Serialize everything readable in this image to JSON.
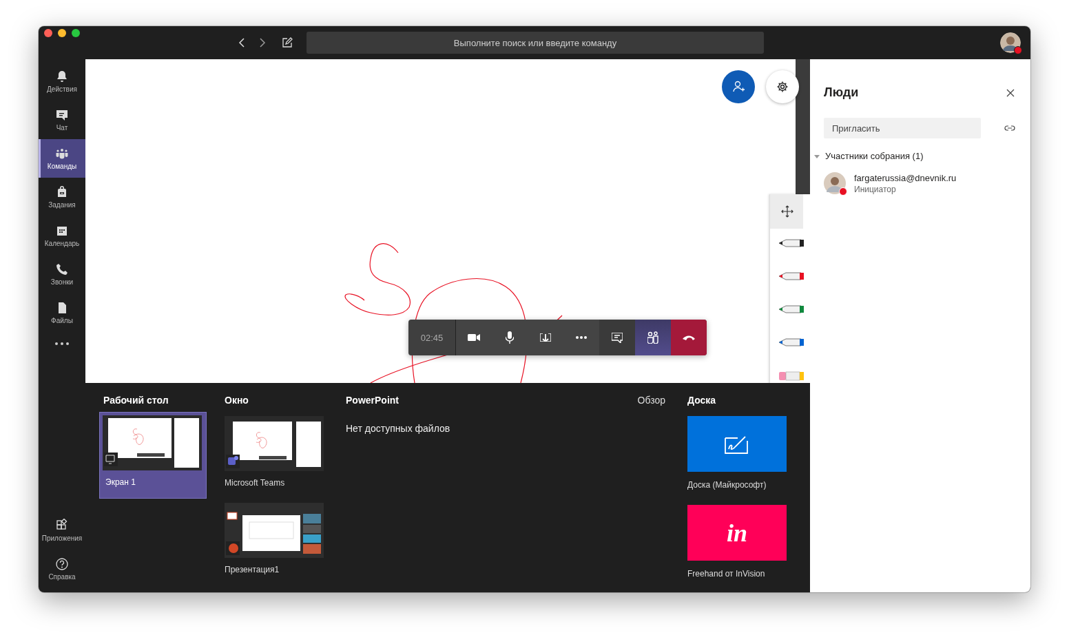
{
  "toolbar": {
    "search": {
      "placeholder": "Выполните поиск или введите команду"
    }
  },
  "rail": {
    "items": [
      {
        "label": "Действия",
        "selected": false
      },
      {
        "label": "Чат",
        "selected": false
      },
      {
        "label": "Команды",
        "selected": true
      },
      {
        "label": "Задания",
        "selected": false
      },
      {
        "label": "Календарь",
        "selected": false
      },
      {
        "label": "Звонки",
        "selected": false
      },
      {
        "label": "Файлы",
        "selected": false
      }
    ],
    "bottom_items": [
      {
        "label": "Приложения"
      },
      {
        "label": "Справка"
      }
    ]
  },
  "call_bar": {
    "timer": "02:45",
    "controls": [
      {
        "kind": "video",
        "selected": false
      },
      {
        "kind": "mic",
        "selected": false
      },
      {
        "kind": "share",
        "selected": false
      },
      {
        "kind": "more",
        "selected": false
      },
      {
        "kind": "chat",
        "selected": false
      },
      {
        "kind": "people",
        "selected": true
      },
      {
        "kind": "hangup",
        "selected": false
      }
    ]
  },
  "pens": [
    {
      "kind": "pen",
      "color": "#222222"
    },
    {
      "kind": "pen",
      "color": "#e81123"
    },
    {
      "kind": "pen",
      "color": "#10893e"
    },
    {
      "kind": "pen",
      "color": "#0063d1"
    },
    {
      "kind": "highlighter",
      "color": "#ffc20e"
    }
  ],
  "share_tray": {
    "desktop": {
      "title": "Рабочий стол",
      "items": [
        {
          "label": "Экран 1",
          "kind": "screen",
          "selected": true
        }
      ]
    },
    "window": {
      "title": "Окно",
      "items": [
        {
          "label": "Microsoft Teams",
          "kind": "teams",
          "selected": false
        },
        {
          "label": "Презентация1",
          "kind": "powerpoint",
          "selected": false
        }
      ]
    },
    "powerpoint": {
      "title": "PowerPoint",
      "empty": "Нет доступных файлов",
      "browse": "Обзор"
    },
    "whiteboard": {
      "title": "Доска",
      "items": [
        {
          "label": "Доска (Майкрософт)",
          "kind": "whiteboard"
        },
        {
          "label": "Freehand от InVision",
          "kind": "invision",
          "logo": "in"
        }
      ]
    }
  },
  "people_panel": {
    "title": "Люди",
    "invite": {
      "placeholder": "Пригласить"
    },
    "group": {
      "label": "Участники собрания (1)",
      "expanded": true,
      "participants": [
        {
          "name": "fargaterussia@dnevnik.ru",
          "role": "Инициатор",
          "color": "#e81123"
        }
      ]
    }
  }
}
